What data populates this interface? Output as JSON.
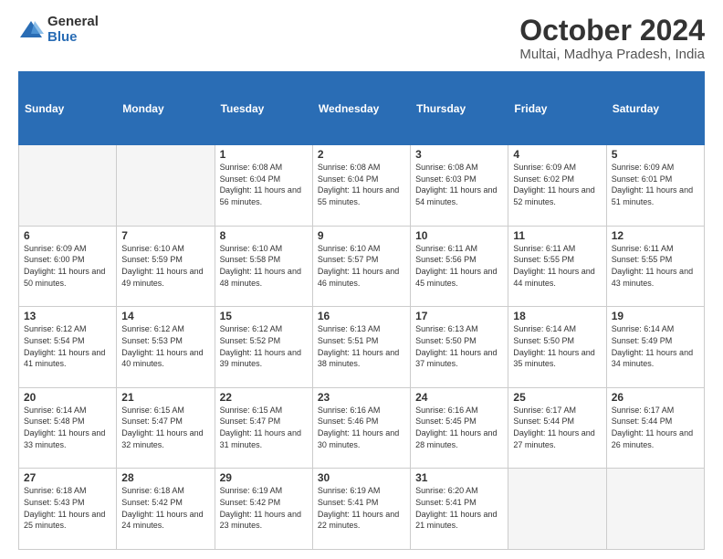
{
  "header": {
    "logo_general": "General",
    "logo_blue": "Blue",
    "month": "October 2024",
    "location": "Multai, Madhya Pradesh, India"
  },
  "days_of_week": [
    "Sunday",
    "Monday",
    "Tuesday",
    "Wednesday",
    "Thursday",
    "Friday",
    "Saturday"
  ],
  "weeks": [
    [
      {
        "day": "",
        "info": ""
      },
      {
        "day": "",
        "info": ""
      },
      {
        "day": "1",
        "info": "Sunrise: 6:08 AM\nSunset: 6:04 PM\nDaylight: 11 hours and 56 minutes."
      },
      {
        "day": "2",
        "info": "Sunrise: 6:08 AM\nSunset: 6:04 PM\nDaylight: 11 hours and 55 minutes."
      },
      {
        "day": "3",
        "info": "Sunrise: 6:08 AM\nSunset: 6:03 PM\nDaylight: 11 hours and 54 minutes."
      },
      {
        "day": "4",
        "info": "Sunrise: 6:09 AM\nSunset: 6:02 PM\nDaylight: 11 hours and 52 minutes."
      },
      {
        "day": "5",
        "info": "Sunrise: 6:09 AM\nSunset: 6:01 PM\nDaylight: 11 hours and 51 minutes."
      }
    ],
    [
      {
        "day": "6",
        "info": "Sunrise: 6:09 AM\nSunset: 6:00 PM\nDaylight: 11 hours and 50 minutes."
      },
      {
        "day": "7",
        "info": "Sunrise: 6:10 AM\nSunset: 5:59 PM\nDaylight: 11 hours and 49 minutes."
      },
      {
        "day": "8",
        "info": "Sunrise: 6:10 AM\nSunset: 5:58 PM\nDaylight: 11 hours and 48 minutes."
      },
      {
        "day": "9",
        "info": "Sunrise: 6:10 AM\nSunset: 5:57 PM\nDaylight: 11 hours and 46 minutes."
      },
      {
        "day": "10",
        "info": "Sunrise: 6:11 AM\nSunset: 5:56 PM\nDaylight: 11 hours and 45 minutes."
      },
      {
        "day": "11",
        "info": "Sunrise: 6:11 AM\nSunset: 5:55 PM\nDaylight: 11 hours and 44 minutes."
      },
      {
        "day": "12",
        "info": "Sunrise: 6:11 AM\nSunset: 5:55 PM\nDaylight: 11 hours and 43 minutes."
      }
    ],
    [
      {
        "day": "13",
        "info": "Sunrise: 6:12 AM\nSunset: 5:54 PM\nDaylight: 11 hours and 41 minutes."
      },
      {
        "day": "14",
        "info": "Sunrise: 6:12 AM\nSunset: 5:53 PM\nDaylight: 11 hours and 40 minutes."
      },
      {
        "day": "15",
        "info": "Sunrise: 6:12 AM\nSunset: 5:52 PM\nDaylight: 11 hours and 39 minutes."
      },
      {
        "day": "16",
        "info": "Sunrise: 6:13 AM\nSunset: 5:51 PM\nDaylight: 11 hours and 38 minutes."
      },
      {
        "day": "17",
        "info": "Sunrise: 6:13 AM\nSunset: 5:50 PM\nDaylight: 11 hours and 37 minutes."
      },
      {
        "day": "18",
        "info": "Sunrise: 6:14 AM\nSunset: 5:50 PM\nDaylight: 11 hours and 35 minutes."
      },
      {
        "day": "19",
        "info": "Sunrise: 6:14 AM\nSunset: 5:49 PM\nDaylight: 11 hours and 34 minutes."
      }
    ],
    [
      {
        "day": "20",
        "info": "Sunrise: 6:14 AM\nSunset: 5:48 PM\nDaylight: 11 hours and 33 minutes."
      },
      {
        "day": "21",
        "info": "Sunrise: 6:15 AM\nSunset: 5:47 PM\nDaylight: 11 hours and 32 minutes."
      },
      {
        "day": "22",
        "info": "Sunrise: 6:15 AM\nSunset: 5:47 PM\nDaylight: 11 hours and 31 minutes."
      },
      {
        "day": "23",
        "info": "Sunrise: 6:16 AM\nSunset: 5:46 PM\nDaylight: 11 hours and 30 minutes."
      },
      {
        "day": "24",
        "info": "Sunrise: 6:16 AM\nSunset: 5:45 PM\nDaylight: 11 hours and 28 minutes."
      },
      {
        "day": "25",
        "info": "Sunrise: 6:17 AM\nSunset: 5:44 PM\nDaylight: 11 hours and 27 minutes."
      },
      {
        "day": "26",
        "info": "Sunrise: 6:17 AM\nSunset: 5:44 PM\nDaylight: 11 hours and 26 minutes."
      }
    ],
    [
      {
        "day": "27",
        "info": "Sunrise: 6:18 AM\nSunset: 5:43 PM\nDaylight: 11 hours and 25 minutes."
      },
      {
        "day": "28",
        "info": "Sunrise: 6:18 AM\nSunset: 5:42 PM\nDaylight: 11 hours and 24 minutes."
      },
      {
        "day": "29",
        "info": "Sunrise: 6:19 AM\nSunset: 5:42 PM\nDaylight: 11 hours and 23 minutes."
      },
      {
        "day": "30",
        "info": "Sunrise: 6:19 AM\nSunset: 5:41 PM\nDaylight: 11 hours and 22 minutes."
      },
      {
        "day": "31",
        "info": "Sunrise: 6:20 AM\nSunset: 5:41 PM\nDaylight: 11 hours and 21 minutes."
      },
      {
        "day": "",
        "info": ""
      },
      {
        "day": "",
        "info": ""
      }
    ]
  ]
}
